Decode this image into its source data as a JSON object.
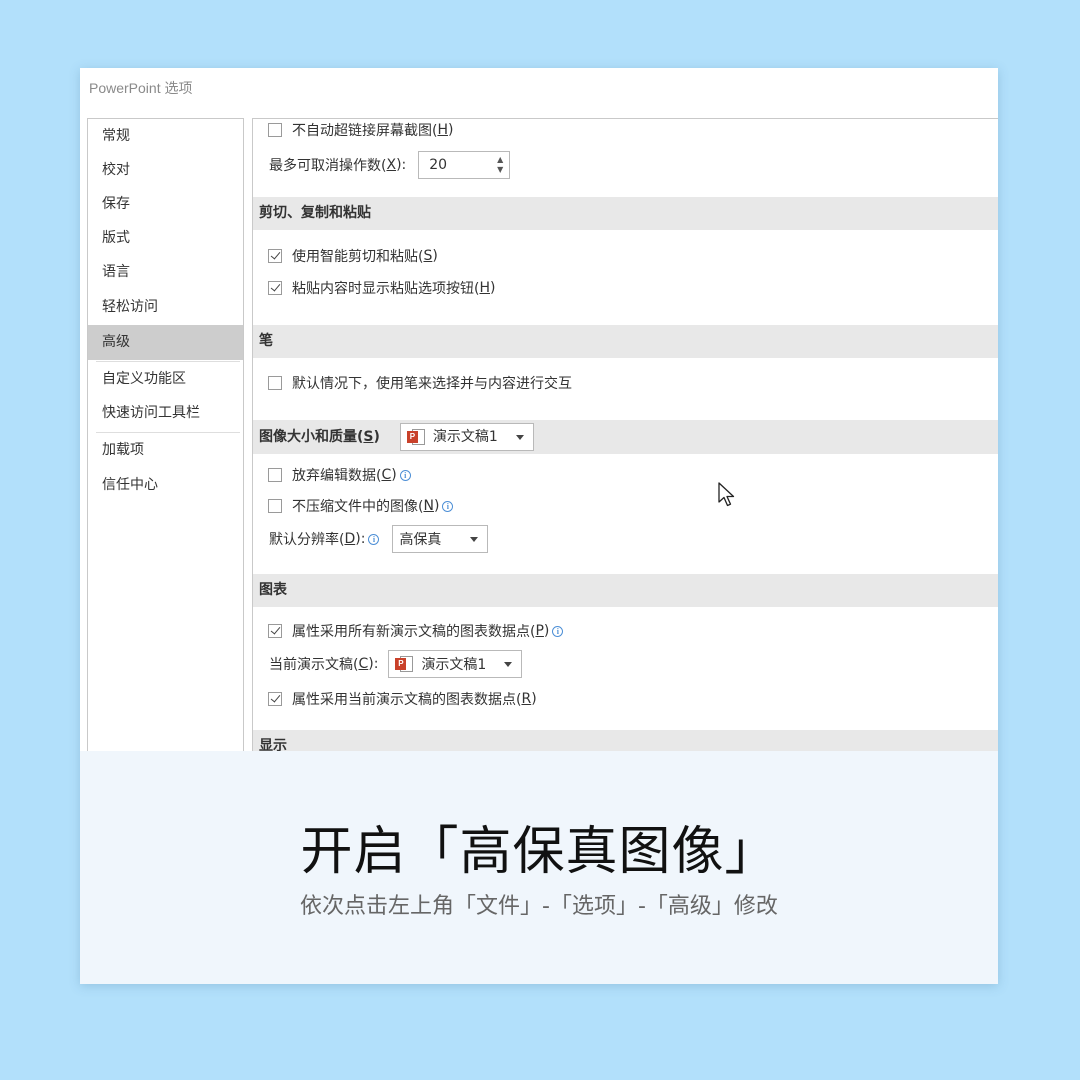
{
  "dialog": {
    "title": "PowerPoint 选项"
  },
  "nav": {
    "items": [
      {
        "label": "常规"
      },
      {
        "label": "校对"
      },
      {
        "label": "保存"
      },
      {
        "label": "版式"
      },
      {
        "label": "语言"
      },
      {
        "label": "轻松访问"
      },
      {
        "label": "高级",
        "active": true
      },
      {
        "label": "自定义功能区"
      },
      {
        "label": "快速访问工具栏"
      },
      {
        "label": "加载项"
      },
      {
        "label": "信任中心"
      }
    ]
  },
  "content": {
    "no_auto_hyperlink": {
      "label": "不自动超链接屏幕截图(",
      "key": "H",
      "checked": false
    },
    "undo": {
      "label": "最多可取消操作数(",
      "key": "X",
      "suffix": "):",
      "value": "20"
    },
    "cut_copy_paste": {
      "heading": "剪切、复制和粘贴",
      "smart_cut": {
        "label": "使用智能剪切和粘贴(",
        "key": "S",
        "checked": true
      },
      "paste_options": {
        "label": "粘贴内容时显示粘贴选项按钮(",
        "key": "H",
        "checked": true
      }
    },
    "pen": {
      "heading": "笔",
      "default_pen": {
        "label": "默认情况下，使用笔来选择并与内容进行交互",
        "checked": false
      }
    },
    "image_quality": {
      "heading": "图像大小和质量(",
      "heading_key": "S",
      "document": "演示文稿1",
      "discard_edit": {
        "label": "放弃编辑数据(",
        "key": "C",
        "checked": false
      },
      "no_compress": {
        "label": "不压缩文件中的图像(",
        "key": "N",
        "checked": false
      },
      "resolution_label": "默认分辨率(",
      "resolution_key": "D",
      "resolution_value": "高保真"
    },
    "chart": {
      "heading": "图表",
      "all_new": {
        "label": "属性采用所有新演示文稿的图表数据点(",
        "key": "P",
        "checked": true
      },
      "current_label": "当前演示文稿(",
      "current_key": "C",
      "current_document": "演示文稿1",
      "current_props": {
        "label": "属性采用当前演示文稿的图表数据点(",
        "key": "R",
        "checked": true
      }
    },
    "display": {
      "heading": "显示"
    }
  },
  "caption": {
    "title": "开启「高保真图像」",
    "subtitle": "依次点击左上角「文件」-「选项」-「高级」修改"
  },
  "icons": {
    "ppt_badge": "P",
    "info": "i"
  },
  "colors": {
    "background": "#b2e0fb",
    "accent_ppt": "#c9412a",
    "info_blue": "#4d8fd6"
  }
}
